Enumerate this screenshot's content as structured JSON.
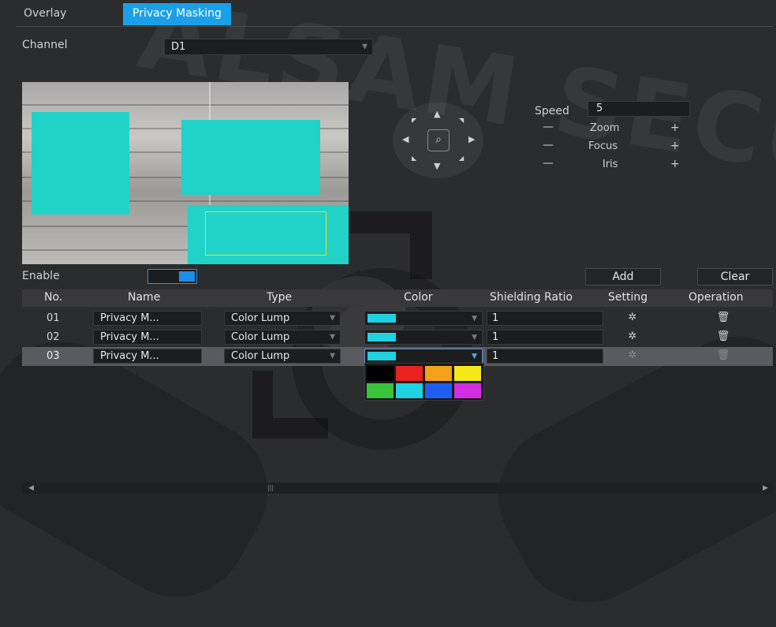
{
  "tabs": [
    {
      "label": "Overlay"
    },
    {
      "label": "Privacy Masking"
    }
  ],
  "channel": {
    "label": "Channel",
    "value": "D1"
  },
  "ptz": {
    "speed_label": "Speed",
    "speed_value": "5",
    "zoom_label": "Zoom",
    "focus_label": "Focus",
    "iris_label": "Iris",
    "minus": "—",
    "plus": "+"
  },
  "enable": {
    "label": "Enable",
    "state": "on"
  },
  "buttons": {
    "add": "Add",
    "clear": "Clear"
  },
  "table": {
    "headers": [
      "No.",
      "Name",
      "Type",
      "Color",
      "Shielding Ratio",
      "Setting",
      "Operation"
    ],
    "rows": [
      {
        "no": "01",
        "name": "Privacy M...",
        "type": "Color Lump",
        "color": "#20d2e0",
        "ratio": "1"
      },
      {
        "no": "02",
        "name": "Privacy M...",
        "type": "Color Lump",
        "color": "#20d2e0",
        "ratio": "1"
      },
      {
        "no": "03",
        "name": "Privacy M...",
        "type": "Color Lump",
        "color": "#20d2e0",
        "ratio": "1"
      }
    ]
  },
  "palette": [
    "#000000",
    "#e8221f",
    "#f4a11a",
    "#f4e81a",
    "#39c23a",
    "#20d2e0",
    "#1f5ef0",
    "#d22ee0"
  ],
  "colors": {
    "accent": "#1aa0e8",
    "mask": "#20d2c8"
  }
}
